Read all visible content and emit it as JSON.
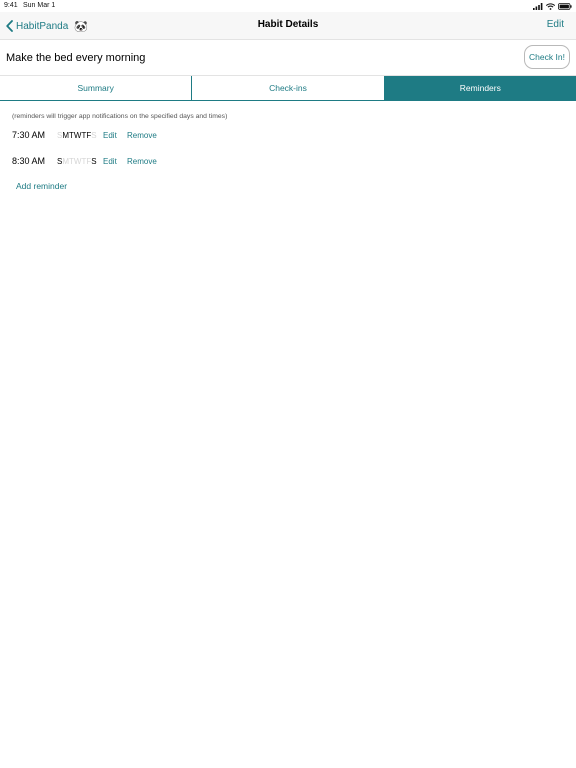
{
  "status": {
    "time": "9:41",
    "date": "Sun Mar 1"
  },
  "nav": {
    "back_label": "HabitPanda",
    "back_icon_glyph": "🐼",
    "title": "Habit Details",
    "edit_label": "Edit"
  },
  "habit": {
    "name": "Make the bed every morning",
    "checkin_label": "Check In!"
  },
  "tabs": [
    {
      "label": "Summary",
      "active": false
    },
    {
      "label": "Check-ins",
      "active": false
    },
    {
      "label": "Reminders",
      "active": true
    }
  ],
  "reminders": {
    "hint": "(reminders will trigger app notifications on the specified days and times)",
    "items": [
      {
        "time": "7:30 AM",
        "days": [
          {
            "letter": "S",
            "on": false
          },
          {
            "letter": "M",
            "on": true
          },
          {
            "letter": "T",
            "on": true
          },
          {
            "letter": "W",
            "on": true
          },
          {
            "letter": "T",
            "on": true
          },
          {
            "letter": "F",
            "on": true
          },
          {
            "letter": "S",
            "on": false
          }
        ],
        "edit_label": "Edit",
        "remove_label": "Remove"
      },
      {
        "time": "8:30 AM",
        "days": [
          {
            "letter": "S",
            "on": true
          },
          {
            "letter": "M",
            "on": false
          },
          {
            "letter": "T",
            "on": false
          },
          {
            "letter": "W",
            "on": false
          },
          {
            "letter": "T",
            "on": false
          },
          {
            "letter": "F",
            "on": false
          },
          {
            "letter": "S",
            "on": true
          }
        ],
        "edit_label": "Edit",
        "remove_label": "Remove"
      }
    ],
    "add_label": "Add reminder"
  },
  "colors": {
    "accent": "#1e7b84",
    "day_on": "#000000",
    "day_off": "#d6d6d6"
  }
}
